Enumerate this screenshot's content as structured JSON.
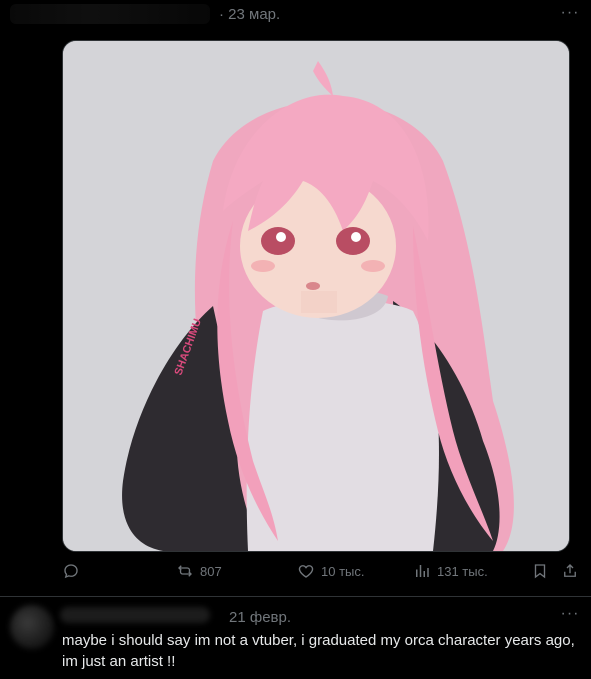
{
  "post": {
    "timestamp": "· 23 мар.",
    "more": "···",
    "media": {
      "alt": "anime illustration of a pink-haired girl in a gray turtleneck and black sleeves",
      "signature_text": "SHACHIMU"
    },
    "actions": {
      "reply": "",
      "reposts": "807",
      "likes": "10 тыс.",
      "views": "131 тыс."
    }
  },
  "reply": {
    "timestamp": "21 февр.",
    "more": "···",
    "text": "maybe i should say im not a vtuber, i graduated my orca character years ago, im just an artist !!"
  },
  "colors": {
    "background": "#000000",
    "text": "#e7e9ea",
    "muted": "#71767b",
    "border": "#2f3336"
  },
  "icons": [
    "reply-icon",
    "repost-icon",
    "like-icon",
    "views-icon",
    "bookmark-icon",
    "share-icon",
    "more-icon"
  ]
}
